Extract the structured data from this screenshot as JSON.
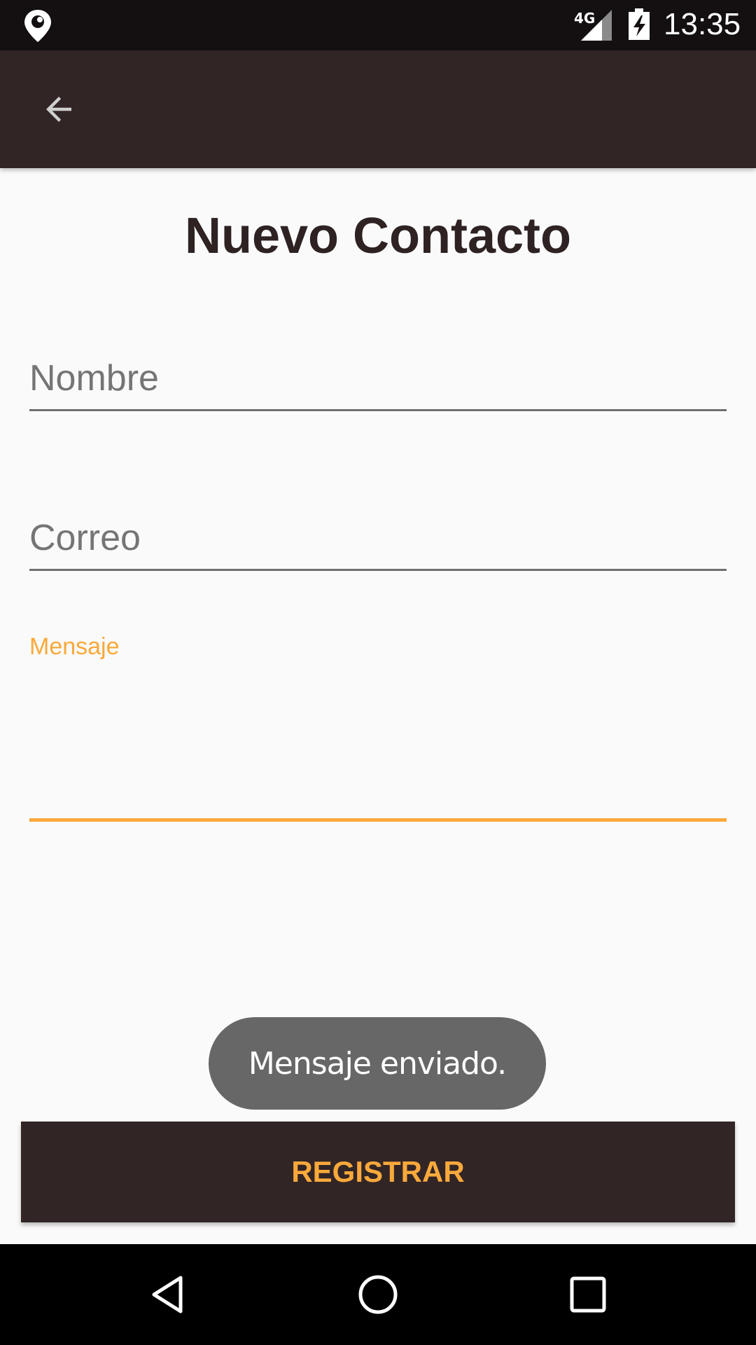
{
  "status_bar": {
    "network": "4G",
    "time": "13:35",
    "icons": [
      "location-pin-icon",
      "signal-icon",
      "battery-charging-icon"
    ]
  },
  "app_bar": {
    "back_icon": "arrow-back-icon"
  },
  "page": {
    "title": "Nuevo Contacto"
  },
  "form": {
    "nombre_placeholder": "Nombre",
    "correo_placeholder": "Correo",
    "mensaje_label": "Mensaje",
    "mensaje_value": ""
  },
  "toast": {
    "text": "Mensaje enviado."
  },
  "register_button": {
    "label": "REGISTRAR"
  },
  "nav_bar": {
    "icons": [
      "nav-back-icon",
      "nav-home-icon",
      "nav-recents-icon"
    ]
  },
  "colors": {
    "app_bar": "#322526",
    "accent": "#f9a93b",
    "background": "#fafafa",
    "toast": "#676767"
  }
}
